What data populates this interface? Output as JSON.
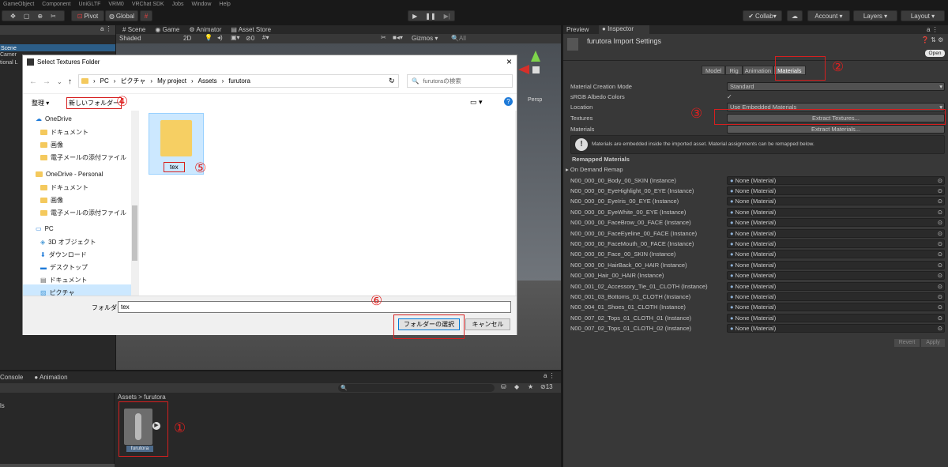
{
  "menu": [
    "GameObject",
    "Component",
    "UniGLTF",
    "VRM0",
    "VRChat SDK",
    "Jobs",
    "Window",
    "Help"
  ],
  "toolbar": {
    "pivot": "Pivot",
    "global": "Global",
    "collab": "Collab",
    "account": "Account",
    "layers": "Layers",
    "layout": "Layout"
  },
  "scene": {
    "tabs": [
      "Scene",
      "Game",
      "Animator",
      "Asset Store"
    ],
    "shaded": "Shaded",
    "mode_2d": "2D",
    "gizmos": "Gizmos",
    "search": "All",
    "persp": "Persp",
    "hier_title": "Scene",
    "hier_items": [
      "Camer",
      "tional L"
    ],
    "layer_count": "0"
  },
  "inspector": {
    "tabs": [
      "Preview",
      "Inspector"
    ],
    "title": "furutora Import Settings",
    "open": "Open",
    "subtabs": [
      "Model",
      "Rig",
      "Animation",
      "Materials"
    ],
    "props": [
      {
        "label": "Material Creation Mode",
        "value": "Standard"
      },
      {
        "label": "sRGB Albedo Colors",
        "value": "✓"
      },
      {
        "label": "Location",
        "value": "Use Embedded Materials"
      }
    ],
    "textures_label": "Textures",
    "extract_textures": "Extract Textures...",
    "materials_label": "Materials",
    "extract_materials": "Extract Materials...",
    "info": "Materials are embedded inside the imported asset. Material assignments can be remapped below.",
    "remapped": "Remapped Materials",
    "on_demand": "On Demand Remap",
    "materials": [
      {
        "name": "N00_000_00_Body_00_SKIN (Instance)",
        "value": "None (Material)"
      },
      {
        "name": "N00_000_00_EyeHighlight_00_EYE (Instance)",
        "value": "None (Material)"
      },
      {
        "name": "N00_000_00_EyeIris_00_EYE (Instance)",
        "value": "None (Material)"
      },
      {
        "name": "N00_000_00_EyeWhite_00_EYE (Instance)",
        "value": "None (Material)"
      },
      {
        "name": "N00_000_00_FaceBrow_00_FACE (Instance)",
        "value": "None (Material)"
      },
      {
        "name": "N00_000_00_FaceEyeline_00_FACE (Instance)",
        "value": "None (Material)"
      },
      {
        "name": "N00_000_00_FaceMouth_00_FACE (Instance)",
        "value": "None (Material)"
      },
      {
        "name": "N00_000_00_Face_00_SKIN (Instance)",
        "value": "None (Material)"
      },
      {
        "name": "N00_000_00_HairBack_00_HAIR (Instance)",
        "value": "None (Material)"
      },
      {
        "name": "N00_000_Hair_00_HAIR (Instance)",
        "value": "None (Material)"
      },
      {
        "name": "N00_001_02_Accessory_Tie_01_CLOTH (Instance)",
        "value": "None (Material)"
      },
      {
        "name": "N00_001_03_Bottoms_01_CLOTH (Instance)",
        "value": "None (Material)"
      },
      {
        "name": "N00_004_01_Shoes_01_CLOTH (Instance)",
        "value": "None (Material)"
      },
      {
        "name": "N00_007_02_Tops_01_CLOTH_01 (Instance)",
        "value": "None (Material)"
      },
      {
        "name": "N00_007_02_Tops_01_CLOTH_02 (Instance)",
        "value": "None (Material)"
      }
    ],
    "revert": "Revert",
    "apply": "Apply"
  },
  "project": {
    "tabs": [
      "Console",
      "Animation"
    ],
    "breadcrumb": "Assets > furutora",
    "asset": "furutora",
    "side": "ls",
    "count": "13"
  },
  "dialog": {
    "title": "Select Textures Folder",
    "path": [
      "PC",
      "ピクチャ",
      "My project",
      "Assets",
      "furutora"
    ],
    "search": "furutoraの検索",
    "organize": "整理 ▾",
    "new_folder": "新しいフォルダー",
    "tree": [
      "OneDrive",
      "ドキュメント",
      "画像",
      "電子メールの添付ファイル",
      "OneDrive - Personal",
      "ドキュメント",
      "画像",
      "電子メールの添付ファイル",
      "PC",
      "3D オブジェクト",
      "ダウンロード",
      "デスクトップ",
      "ドキュメント",
      "ピクチャ"
    ],
    "folder_name": "tex",
    "folder_label": "フォルダー:",
    "folder_value": "tex",
    "select": "フォルダーの選択",
    "cancel": "キャンセル"
  },
  "callouts": [
    "①",
    "②",
    "③",
    "④",
    "⑤",
    "⑥"
  ]
}
